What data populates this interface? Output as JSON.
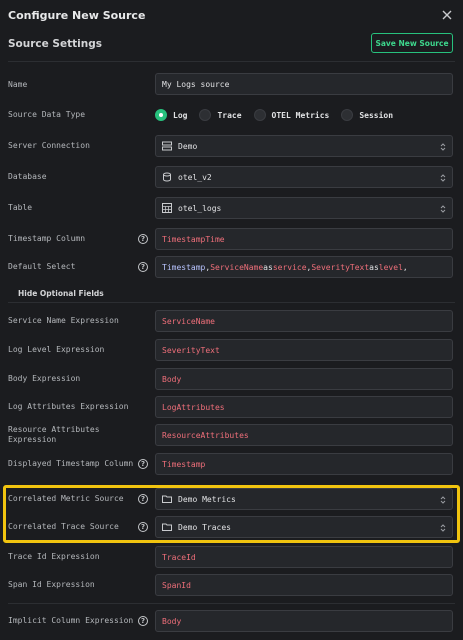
{
  "header": {
    "title": "Configure New Source"
  },
  "settings": {
    "title": "Source Settings",
    "save_label": "Save New Source"
  },
  "fields": {
    "name": {
      "label": "Name",
      "value": "My Logs source"
    },
    "data_type": {
      "label": "Source Data Type",
      "options": [
        "Log",
        "Trace",
        "OTEL Metrics",
        "Session"
      ],
      "selected": "Log"
    },
    "connection": {
      "label": "Server Connection",
      "value": "Demo"
    },
    "database": {
      "label": "Database",
      "value": "otel_v2"
    },
    "table": {
      "label": "Table",
      "value": "otel_logs"
    },
    "timestamp_column": {
      "label": "Timestamp Column",
      "value": "TimestampTime"
    },
    "default_select": {
      "label": "Default Select",
      "parts": [
        "Timestamp",
        ", ",
        "ServiceName",
        " as ",
        "service",
        ", ",
        "SeverityText",
        " as ",
        "level",
        ","
      ]
    },
    "hide_optional": {
      "label": "Hide Optional Fields"
    },
    "service_name": {
      "label": "Service Name Expression",
      "value": "ServiceName"
    },
    "log_level": {
      "label": "Log Level Expression",
      "value": "SeverityText"
    },
    "body": {
      "label": "Body Expression",
      "value": "Body"
    },
    "log_attributes": {
      "label": "Log Attributes Expression",
      "value": "LogAttributes"
    },
    "resource_attributes": {
      "label_line1": "Resource Attributes",
      "label_line2": "Expression",
      "value": "ResourceAttributes"
    },
    "displayed_timestamp": {
      "label": "Displayed Timestamp Column",
      "value": "Timestamp"
    },
    "correlated_metric": {
      "label": "Correlated Metric Source",
      "value": "Demo Metrics"
    },
    "correlated_trace": {
      "label": "Correlated Trace Source",
      "value": "Demo Traces"
    },
    "trace_id": {
      "label": "Trace Id Expression",
      "value": "TraceId"
    },
    "span_id": {
      "label": "Span Id Expression",
      "value": "SpanId"
    },
    "implicit_column": {
      "label": "Implicit Column Expression",
      "value": "Body"
    }
  },
  "icons": {
    "close": "close-icon",
    "help": "help-circle-icon",
    "server": "server-icon",
    "database": "database-icon",
    "table": "table-icon",
    "folder": "folder-icon",
    "chevron": "chevron-up-down-icon"
  },
  "colors": {
    "accent": "#27c17d",
    "highlight": "#f1c40f",
    "code_text": "#ef6f7a",
    "keyword": "#b8c4ff"
  }
}
